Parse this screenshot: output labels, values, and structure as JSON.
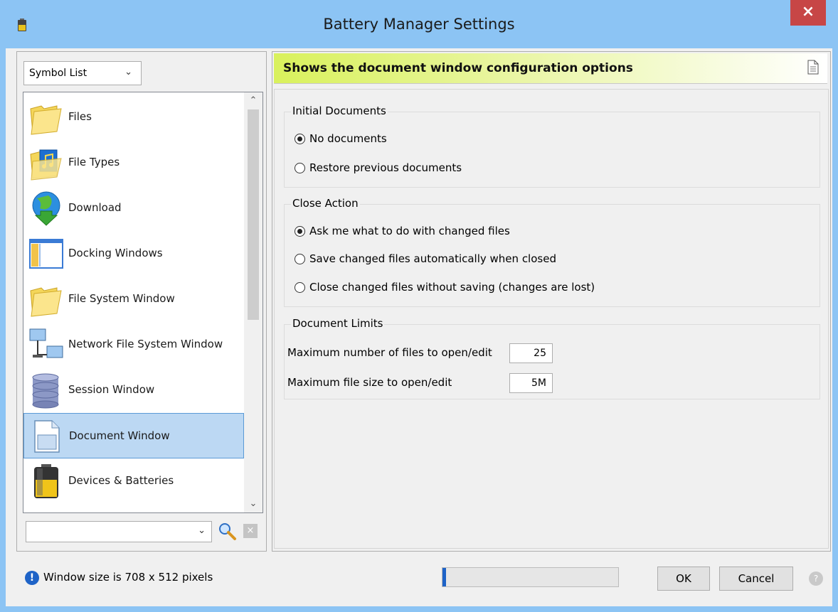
{
  "window": {
    "title": "Battery Manager Settings",
    "close_glyph": "×"
  },
  "sidebar": {
    "view_select": {
      "value": "Symbol List"
    },
    "items": [
      {
        "label": "Files",
        "icon": "folder-icon"
      },
      {
        "label": "File Types",
        "icon": "music-folder-icon"
      },
      {
        "label": "Download",
        "icon": "globe-download-icon"
      },
      {
        "label": "Docking Windows",
        "icon": "docking-window-icon"
      },
      {
        "label": "File System Window",
        "icon": "folder-icon"
      },
      {
        "label": "Network File System Window",
        "icon": "network-computers-icon"
      },
      {
        "label": "Session Window",
        "icon": "database-icon"
      },
      {
        "label": "Document Window",
        "icon": "document-window-icon",
        "selected": true
      },
      {
        "label": "Devices & Batteries",
        "icon": "battery-icon"
      }
    ],
    "search": {
      "value": ""
    },
    "clear_glyph": "×"
  },
  "main": {
    "banner": "Shows the document window configuration options",
    "initial_documents": {
      "title": "Initial Documents",
      "options": [
        {
          "label": "No documents",
          "checked": true
        },
        {
          "label": "Restore previous documents",
          "checked": false
        }
      ]
    },
    "close_action": {
      "title": "Close Action",
      "options": [
        {
          "label": "Ask me what to do with changed files",
          "checked": true
        },
        {
          "label": "Save changed files automatically when closed",
          "checked": false
        },
        {
          "label": "Close changed files without saving (changes are lost)",
          "checked": false
        }
      ]
    },
    "document_limits": {
      "title": "Document Limits",
      "max_files_label": "Maximum number of files to open/edit",
      "max_files_value": "25",
      "max_size_label": "Maximum file size to open/edit",
      "max_size_value": "5M"
    }
  },
  "status": {
    "info_glyph": "!",
    "text": "Window size is 708 x 512 pixels",
    "progress": 0.01
  },
  "buttons": {
    "ok": "OK",
    "cancel": "Cancel",
    "help_glyph": "?"
  },
  "colors": {
    "titlebar": "#8cc4f4",
    "close": "#c74646",
    "selection": "#bcd8f3",
    "banner_start": "#d9f15c",
    "accent": "#1e63c7"
  }
}
